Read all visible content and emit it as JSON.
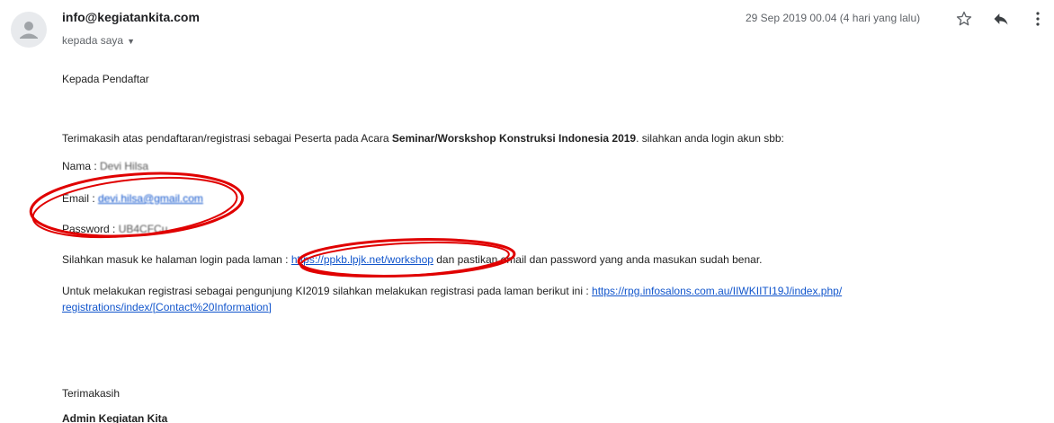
{
  "header": {
    "sender": "info@kegiatankita.com",
    "recipient": "kepada saya",
    "date": "29 Sep 2019 00.04 (4 hari yang lalu)"
  },
  "icons": {
    "avatar": "person-icon",
    "star": "star-icon",
    "reply": "reply-icon",
    "more": "more-vertical-icon",
    "recipient_toggle": "caret-down-icon"
  },
  "body": {
    "greeting": "Kepada Pendaftar",
    "intro_before": "Terimakasih atas pendaftaran/registrasi sebagai Peserta pada Acara ",
    "intro_event": "Seminar/Worskshop Konstruksi Indonesia 2019",
    "intro_after": ". silahkan anda login akun sbb:",
    "nama_label": "Nama : ",
    "nama_value": "Devi Hilsa",
    "email_label": "Email : ",
    "email_value": "devi.hilsa@gmail.com",
    "password_label": "Password : ",
    "password_value": "UB4CFCu",
    "login_before": "Silahkan masuk ke halaman login pada laman : ",
    "login_link": "https://ppkb.lpjk.net/workshop",
    "login_after": " dan pastikan email dan password yang anda masukan sudah benar.",
    "visitor_before": "Untuk melakukan registrasi sebagai pengunjung KI2019 silahkan melakukan registrasi pada laman berikut ini : ",
    "visitor_link_1": "https://rpg.infosalons.com.au/IIWKIITI19J/index.php/",
    "visitor_link_2": "registrations/index/[Contact%20Information]",
    "closing": "Terimakasih",
    "signature": "Admin Kegiatan Kita"
  },
  "colors": {
    "link": "#1155cc",
    "annotation": "#e00000"
  }
}
